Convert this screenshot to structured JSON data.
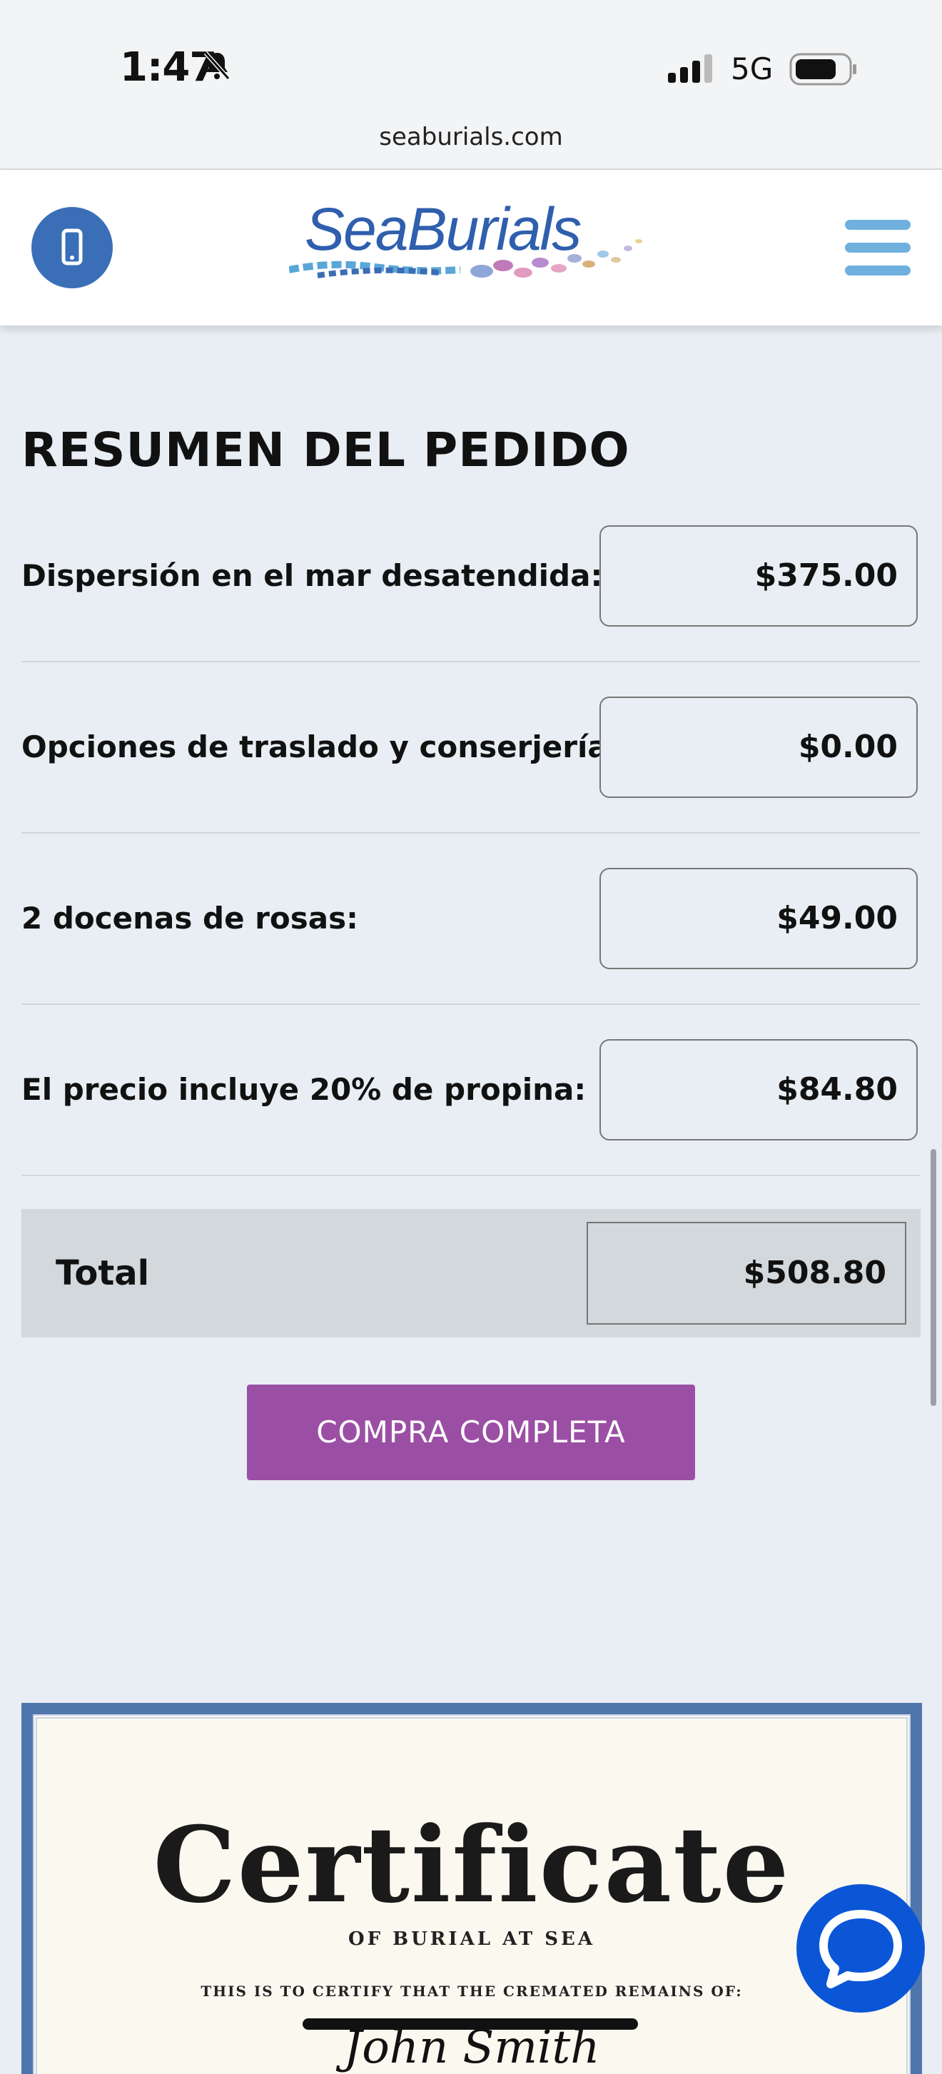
{
  "status_bar": {
    "time": "1:47",
    "network": "5G"
  },
  "browser": {
    "url": "seaburials.com"
  },
  "header": {
    "logo_text": "SeaBurials"
  },
  "summary": {
    "title": "RESUMEN DEL PEDIDO",
    "rows": [
      {
        "label": "Dispersión en el mar desatendida:",
        "value": "$375.00"
      },
      {
        "label": "Opciones de traslado y conserjería:",
        "value": "$0.00"
      },
      {
        "label": "2 docenas de rosas:",
        "value": "$49.00"
      },
      {
        "label": "El precio incluye 20% de propina:",
        "value": "$84.80"
      }
    ],
    "total_label": "Total",
    "total_value": "$508.80",
    "buy_label": "COMPRA COMPLETA"
  },
  "certificate": {
    "title": "Certificate",
    "subtitle": "OF BURIAL AT SEA",
    "line": "THIS IS TO CERTIFY THAT THE CREMATED REMAINS OF:",
    "name": "John Smith"
  },
  "colors": {
    "accent": "#9b4fa4",
    "brand_blue": "#3a6fb8",
    "chat_blue": "#0b56d6"
  }
}
